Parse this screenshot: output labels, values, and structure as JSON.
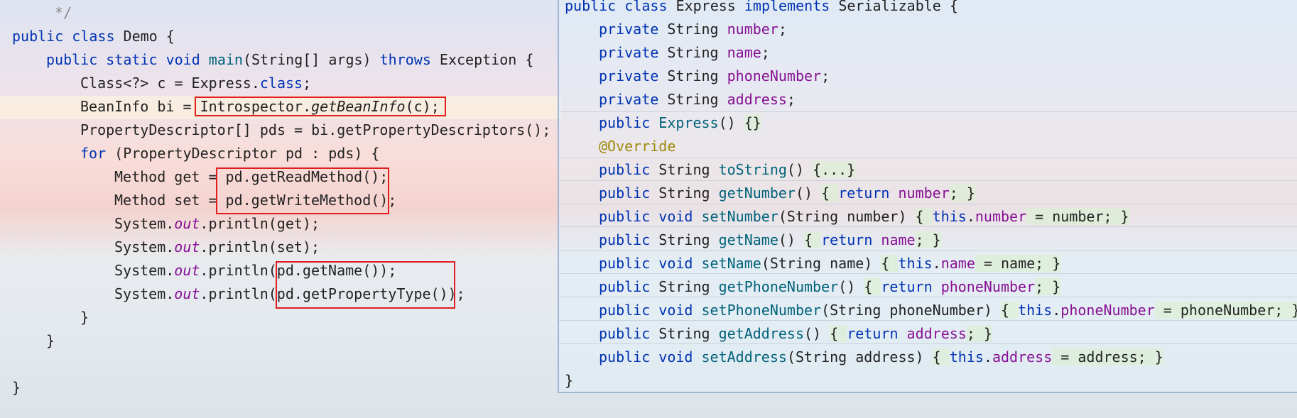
{
  "left_code": [
    {
      "indent": 1,
      "tokens": [
        {
          "t": " */",
          "c": "cm"
        }
      ]
    },
    {
      "indent": 0,
      "tokens": [
        {
          "t": "public ",
          "c": "kw"
        },
        {
          "t": "class ",
          "c": "kw"
        },
        {
          "t": "Demo {",
          "c": ""
        }
      ]
    },
    {
      "indent": 1,
      "tokens": [
        {
          "t": "public static void ",
          "c": "kw"
        },
        {
          "t": "main",
          "c": "fn"
        },
        {
          "t": "(String[] args) ",
          "c": ""
        },
        {
          "t": "throws ",
          "c": "kw"
        },
        {
          "t": "Exception {",
          "c": ""
        }
      ]
    },
    {
      "indent": 2,
      "tokens": [
        {
          "t": "Class<?> c = Express.",
          "c": ""
        },
        {
          "t": "class",
          "c": "kw"
        },
        {
          "t": ";",
          "c": ""
        }
      ]
    },
    {
      "indent": 2,
      "tokens": [
        {
          "t": "BeanInfo bi = ",
          "c": ""
        },
        {
          "t": "Introspector.",
          "c": ""
        },
        {
          "t": "getBeanInfo",
          "c": "it"
        },
        {
          "t": "(c);",
          "c": ""
        }
      ]
    },
    {
      "indent": 2,
      "tokens": [
        {
          "t": "PropertyDescriptor[] pds = bi.getPropertyDescriptors();",
          "c": ""
        }
      ]
    },
    {
      "indent": 2,
      "tokens": [
        {
          "t": "for ",
          "c": "kw"
        },
        {
          "t": "(PropertyDescriptor pd : pds) {",
          "c": ""
        }
      ]
    },
    {
      "indent": 3,
      "tokens": [
        {
          "t": "Method get = pd.getReadMethod();",
          "c": ""
        }
      ]
    },
    {
      "indent": 3,
      "tokens": [
        {
          "t": "Method set = pd.getWriteMethod();",
          "c": ""
        }
      ]
    },
    {
      "indent": 3,
      "tokens": [
        {
          "t": "System.",
          "c": ""
        },
        {
          "t": "out",
          "c": "out"
        },
        {
          "t": ".println(get);",
          "c": ""
        }
      ]
    },
    {
      "indent": 3,
      "tokens": [
        {
          "t": "System.",
          "c": ""
        },
        {
          "t": "out",
          "c": "out"
        },
        {
          "t": ".println(set);",
          "c": ""
        }
      ]
    },
    {
      "indent": 3,
      "tokens": [
        {
          "t": "System.",
          "c": ""
        },
        {
          "t": "out",
          "c": "out"
        },
        {
          "t": ".println(pd.getName());",
          "c": ""
        }
      ]
    },
    {
      "indent": 3,
      "tokens": [
        {
          "t": "System.",
          "c": ""
        },
        {
          "t": "out",
          "c": "out"
        },
        {
          "t": ".println(pd.getPropertyType());",
          "c": ""
        }
      ]
    },
    {
      "indent": 2,
      "tokens": [
        {
          "t": "}",
          "c": ""
        }
      ]
    },
    {
      "indent": 1,
      "tokens": [
        {
          "t": "}",
          "c": ""
        }
      ]
    },
    {
      "indent": 0,
      "tokens": []
    },
    {
      "indent": 0,
      "tokens": [
        {
          "t": "}",
          "c": ""
        }
      ]
    }
  ],
  "right_code": [
    {
      "indent": 0,
      "tokens": [
        {
          "t": "public ",
          "c": "kw"
        },
        {
          "t": "class ",
          "c": "kw"
        },
        {
          "t": "Express ",
          "c": ""
        },
        {
          "t": "implements ",
          "c": "kw"
        },
        {
          "t": "Serializable {",
          "c": ""
        }
      ]
    },
    {
      "indent": 1,
      "tokens": [
        {
          "t": "private ",
          "c": "kw"
        },
        {
          "t": "String ",
          "c": ""
        },
        {
          "t": "number",
          "c": "fld"
        },
        {
          "t": ";",
          "c": ""
        }
      ]
    },
    {
      "indent": 1,
      "tokens": [
        {
          "t": "private ",
          "c": "kw"
        },
        {
          "t": "String ",
          "c": ""
        },
        {
          "t": "name",
          "c": "fld"
        },
        {
          "t": ";",
          "c": ""
        }
      ]
    },
    {
      "indent": 1,
      "tokens": [
        {
          "t": "private ",
          "c": "kw"
        },
        {
          "t": "String ",
          "c": ""
        },
        {
          "t": "phoneNumber",
          "c": "fld"
        },
        {
          "t": ";",
          "c": ""
        }
      ]
    },
    {
      "indent": 1,
      "tokens": [
        {
          "t": "private ",
          "c": "kw"
        },
        {
          "t": "String ",
          "c": ""
        },
        {
          "t": "address",
          "c": "fld"
        },
        {
          "t": ";",
          "c": ""
        }
      ]
    },
    {
      "indent": 1,
      "tokens": [
        {
          "t": "public ",
          "c": "kw"
        },
        {
          "t": "Express",
          "c": "fn"
        },
        {
          "t": "() ",
          "c": ""
        },
        {
          "t": "{}",
          "c": "fold"
        }
      ]
    },
    {
      "indent": 1,
      "tokens": [
        {
          "t": "@Override",
          "c": "ann"
        }
      ]
    },
    {
      "indent": 1,
      "tokens": [
        {
          "t": "public ",
          "c": "kw"
        },
        {
          "t": "String ",
          "c": ""
        },
        {
          "t": "toString",
          "c": "fn"
        },
        {
          "t": "() ",
          "c": ""
        },
        {
          "t": "{...}",
          "c": "fold"
        }
      ]
    },
    {
      "indent": 1,
      "tokens": [
        {
          "t": "public ",
          "c": "kw"
        },
        {
          "t": "String ",
          "c": ""
        },
        {
          "t": "getNumber",
          "c": "fn"
        },
        {
          "t": "() ",
          "c": ""
        },
        {
          "t": "{ ",
          "c": "fold"
        },
        {
          "t": "return ",
          "c": "kw"
        },
        {
          "t": "number",
          "c": "fld"
        },
        {
          "t": "; }",
          "c": "fold"
        }
      ]
    },
    {
      "indent": 1,
      "tokens": [
        {
          "t": "public ",
          "c": "kw"
        },
        {
          "t": "void ",
          "c": "kw"
        },
        {
          "t": "setNumber",
          "c": "fn"
        },
        {
          "t": "(String number) ",
          "c": ""
        },
        {
          "t": "{ ",
          "c": "fold"
        },
        {
          "t": "this",
          "c": "kw"
        },
        {
          "t": ".",
          "c": ""
        },
        {
          "t": "number",
          "c": "fld"
        },
        {
          "t": " = number; }",
          "c": "fold"
        }
      ]
    },
    {
      "indent": 1,
      "tokens": [
        {
          "t": "public ",
          "c": "kw"
        },
        {
          "t": "String ",
          "c": ""
        },
        {
          "t": "getName",
          "c": "fn"
        },
        {
          "t": "() ",
          "c": ""
        },
        {
          "t": "{ ",
          "c": "fold"
        },
        {
          "t": "return ",
          "c": "kw"
        },
        {
          "t": "name",
          "c": "fld"
        },
        {
          "t": "; }",
          "c": "fold"
        }
      ]
    },
    {
      "indent": 1,
      "tokens": [
        {
          "t": "public ",
          "c": "kw"
        },
        {
          "t": "void ",
          "c": "kw"
        },
        {
          "t": "setName",
          "c": "fn"
        },
        {
          "t": "(String name) ",
          "c": ""
        },
        {
          "t": "{ ",
          "c": "fold"
        },
        {
          "t": "this",
          "c": "kw"
        },
        {
          "t": ".",
          "c": ""
        },
        {
          "t": "name",
          "c": "fld"
        },
        {
          "t": " = name; }",
          "c": "fold"
        }
      ]
    },
    {
      "indent": 1,
      "tokens": [
        {
          "t": "public ",
          "c": "kw"
        },
        {
          "t": "String ",
          "c": ""
        },
        {
          "t": "getPhoneNumber",
          "c": "fn"
        },
        {
          "t": "() ",
          "c": ""
        },
        {
          "t": "{ ",
          "c": "fold"
        },
        {
          "t": "return ",
          "c": "kw"
        },
        {
          "t": "phoneNumber",
          "c": "fld"
        },
        {
          "t": "; }",
          "c": "fold"
        }
      ]
    },
    {
      "indent": 1,
      "tokens": [
        {
          "t": "public ",
          "c": "kw"
        },
        {
          "t": "void ",
          "c": "kw"
        },
        {
          "t": "setPhoneNumber",
          "c": "fn"
        },
        {
          "t": "(String phoneNumber) ",
          "c": ""
        },
        {
          "t": "{ ",
          "c": "fold"
        },
        {
          "t": "this",
          "c": "kw"
        },
        {
          "t": ".",
          "c": ""
        },
        {
          "t": "phoneNumber",
          "c": "fld"
        },
        {
          "t": " = phoneNumber; }",
          "c": "fold"
        }
      ]
    },
    {
      "indent": 1,
      "tokens": [
        {
          "t": "public ",
          "c": "kw"
        },
        {
          "t": "String ",
          "c": ""
        },
        {
          "t": "getAddress",
          "c": "fn"
        },
        {
          "t": "() ",
          "c": ""
        },
        {
          "t": "{ ",
          "c": "fold"
        },
        {
          "t": "return ",
          "c": "kw"
        },
        {
          "t": "address",
          "c": "fld"
        },
        {
          "t": "; }",
          "c": "fold"
        }
      ]
    },
    {
      "indent": 1,
      "tokens": [
        {
          "t": "public ",
          "c": "kw"
        },
        {
          "t": "void ",
          "c": "kw"
        },
        {
          "t": "setAddress",
          "c": "fn"
        },
        {
          "t": "(String address) ",
          "c": ""
        },
        {
          "t": "{ ",
          "c": "fold"
        },
        {
          "t": "this",
          "c": "kw"
        },
        {
          "t": ".",
          "c": ""
        },
        {
          "t": "address",
          "c": "fld"
        },
        {
          "t": " = address; }",
          "c": "fold"
        }
      ]
    },
    {
      "indent": 0,
      "tokens": [
        {
          "t": "}",
          "c": ""
        }
      ]
    }
  ],
  "colors": {
    "keyword": "#0033b3",
    "method": "#00627a",
    "field": "#871094",
    "annotation": "#9e880d",
    "highlight_box": "#e01e1e"
  }
}
